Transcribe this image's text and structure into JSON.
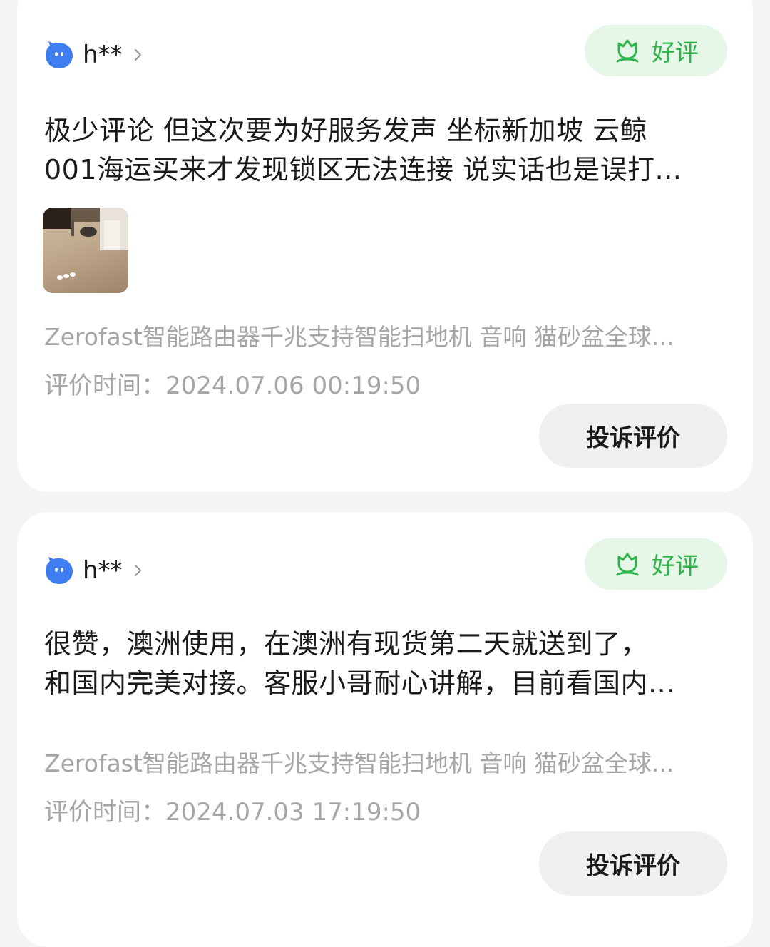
{
  "reviews": [
    {
      "user": "h**",
      "badge_label": "好评",
      "text_line1": "极少评论 但这次要为好服务发声   坐标新加坡 云鲸",
      "text_line2": "001海运买来才发现锁区无法连接 说实话也是误打...",
      "has_photo": true,
      "product": "Zerofast智能路由器千兆支持智能扫地机 音响 猫砂盆全球...",
      "time_label": "评价时间：",
      "time_value": "2024.07.06 00:19:50",
      "complain_label": "投诉评价"
    },
    {
      "user": "h**",
      "badge_label": "好评",
      "text_line1": "很赞，澳洲使用，在澳洲有现货第二天就送到了，",
      "text_line2": "和国内完美对接。客服小哥耐心讲解，目前看国内...",
      "has_photo": false,
      "product": "Zerofast智能路由器千兆支持智能扫地机 音响 猫砂盆全球...",
      "time_label": "评价时间：",
      "time_value": "2024.07.03 17:19:50",
      "complain_label": "投诉评价"
    }
  ],
  "colors": {
    "page_bg": "#f4f4f6",
    "card_bg": "#ffffff",
    "badge_bg": "#e6f7e8",
    "badge_fg": "#2fb44b",
    "avatar_blue": "#3e7ef0",
    "muted_text": "#a6a6a6"
  },
  "icons": {
    "avatar": "blue-bird-avatar-icon",
    "chevron": "chevron-right-icon",
    "badge": "tulip-icon"
  }
}
